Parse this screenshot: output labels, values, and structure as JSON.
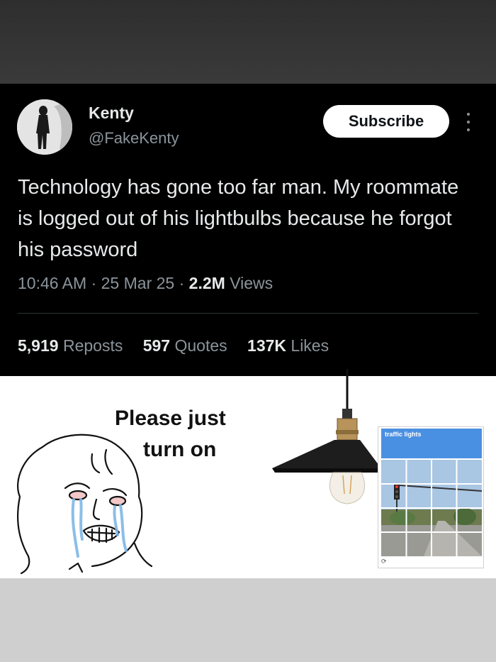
{
  "post": {
    "author_name": "Kenty",
    "author_handle": "@FakeKenty",
    "subscribe_label": "Subscribe",
    "more_icon": "more-vertical-icon",
    "text": "Technology has gone too far man. My roommate is logged out of his lightbulbs because he forgot his password",
    "time": "10:46 AM",
    "date": "25 Mar 25",
    "views_count": "2.2M",
    "views_label": "Views",
    "separator": "·",
    "stats": {
      "reposts_count": "5,919",
      "reposts_label": "Reposts",
      "quotes_count": "597",
      "quotes_label": "Quotes",
      "likes_count": "137K",
      "likes_label": "Likes"
    }
  },
  "meme": {
    "caption_line1": "Please just",
    "caption_line2": "turn on",
    "captcha_title": "traffic lights",
    "captcha_refresh_icon": "refresh-icon"
  },
  "colors": {
    "tweet_bg": "#000000",
    "text_primary": "#e7e9ea",
    "text_secondary": "#8b949b",
    "captcha_blue": "#4a90e2"
  }
}
